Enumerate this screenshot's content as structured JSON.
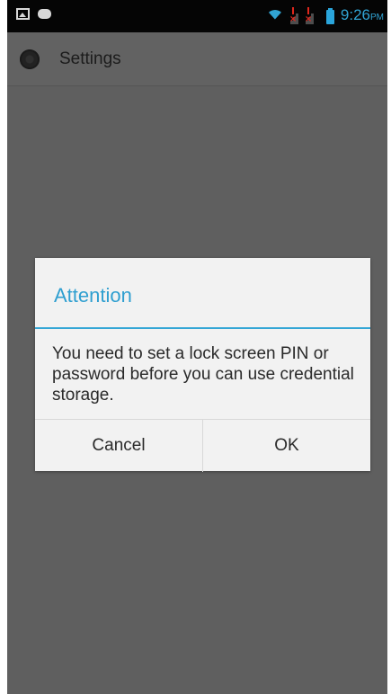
{
  "status_bar": {
    "time": "9:26",
    "ampm": "PM",
    "icons": [
      "gallery-icon",
      "chat-icon",
      "wifi-icon",
      "signal-icon",
      "signal-icon",
      "battery-icon"
    ]
  },
  "action_bar": {
    "title": "Settings",
    "icon": "settings-icon"
  },
  "dialog": {
    "title": "Attention",
    "message": "You need to set a lock screen PIN or password before you can use credential storage.",
    "cancel_label": "Cancel",
    "ok_label": "OK"
  },
  "colors": {
    "accent": "#33a6d6",
    "status_bar": "#050505",
    "background": "#5f5f5f",
    "dialog": "#f2f2f2"
  }
}
